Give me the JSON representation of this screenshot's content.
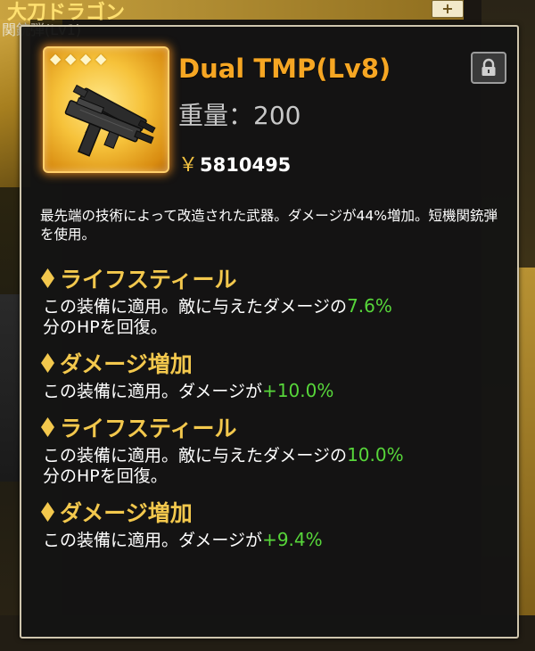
{
  "background": {
    "title": "大刀ドラゴン",
    "subtitle": "関銃弾(Lv1)",
    "plus_label": "+"
  },
  "item": {
    "name": "Dual TMP(Lv8)",
    "weight": "重量：200",
    "price_symbol": "￥",
    "price": "5810495",
    "stars": 4,
    "icon": "smg-icon",
    "lock_icon": "lock-icon",
    "description": "最先端の技術によって改造された武器。ダメージが44%増加。短機関銃弾を使用。"
  },
  "effects": [
    {
      "title": "ライフスティール",
      "text_before": "この装備に適用。敵に与えたダメージの",
      "value": "7.6%",
      "text_after": "分のHPを回復。"
    },
    {
      "title": "ダメージ増加",
      "text_before": "この装備に適用。ダメージが",
      "value": "+10.0%",
      "text_after": ""
    },
    {
      "title": "ライフスティール",
      "text_before": "この装備に適用。敵に与えたダメージの",
      "value": "10.0%",
      "text_after": "分のHPを回復。"
    },
    {
      "title": "ダメージ増加",
      "text_before": "この装備に適用。ダメージが",
      "value": "+9.4%",
      "text_after": ""
    }
  ],
  "colors": {
    "name": "#f6a623",
    "effect_title": "#f3c84d",
    "effect_value": "#57d63a",
    "frame": "#f6c23a"
  }
}
